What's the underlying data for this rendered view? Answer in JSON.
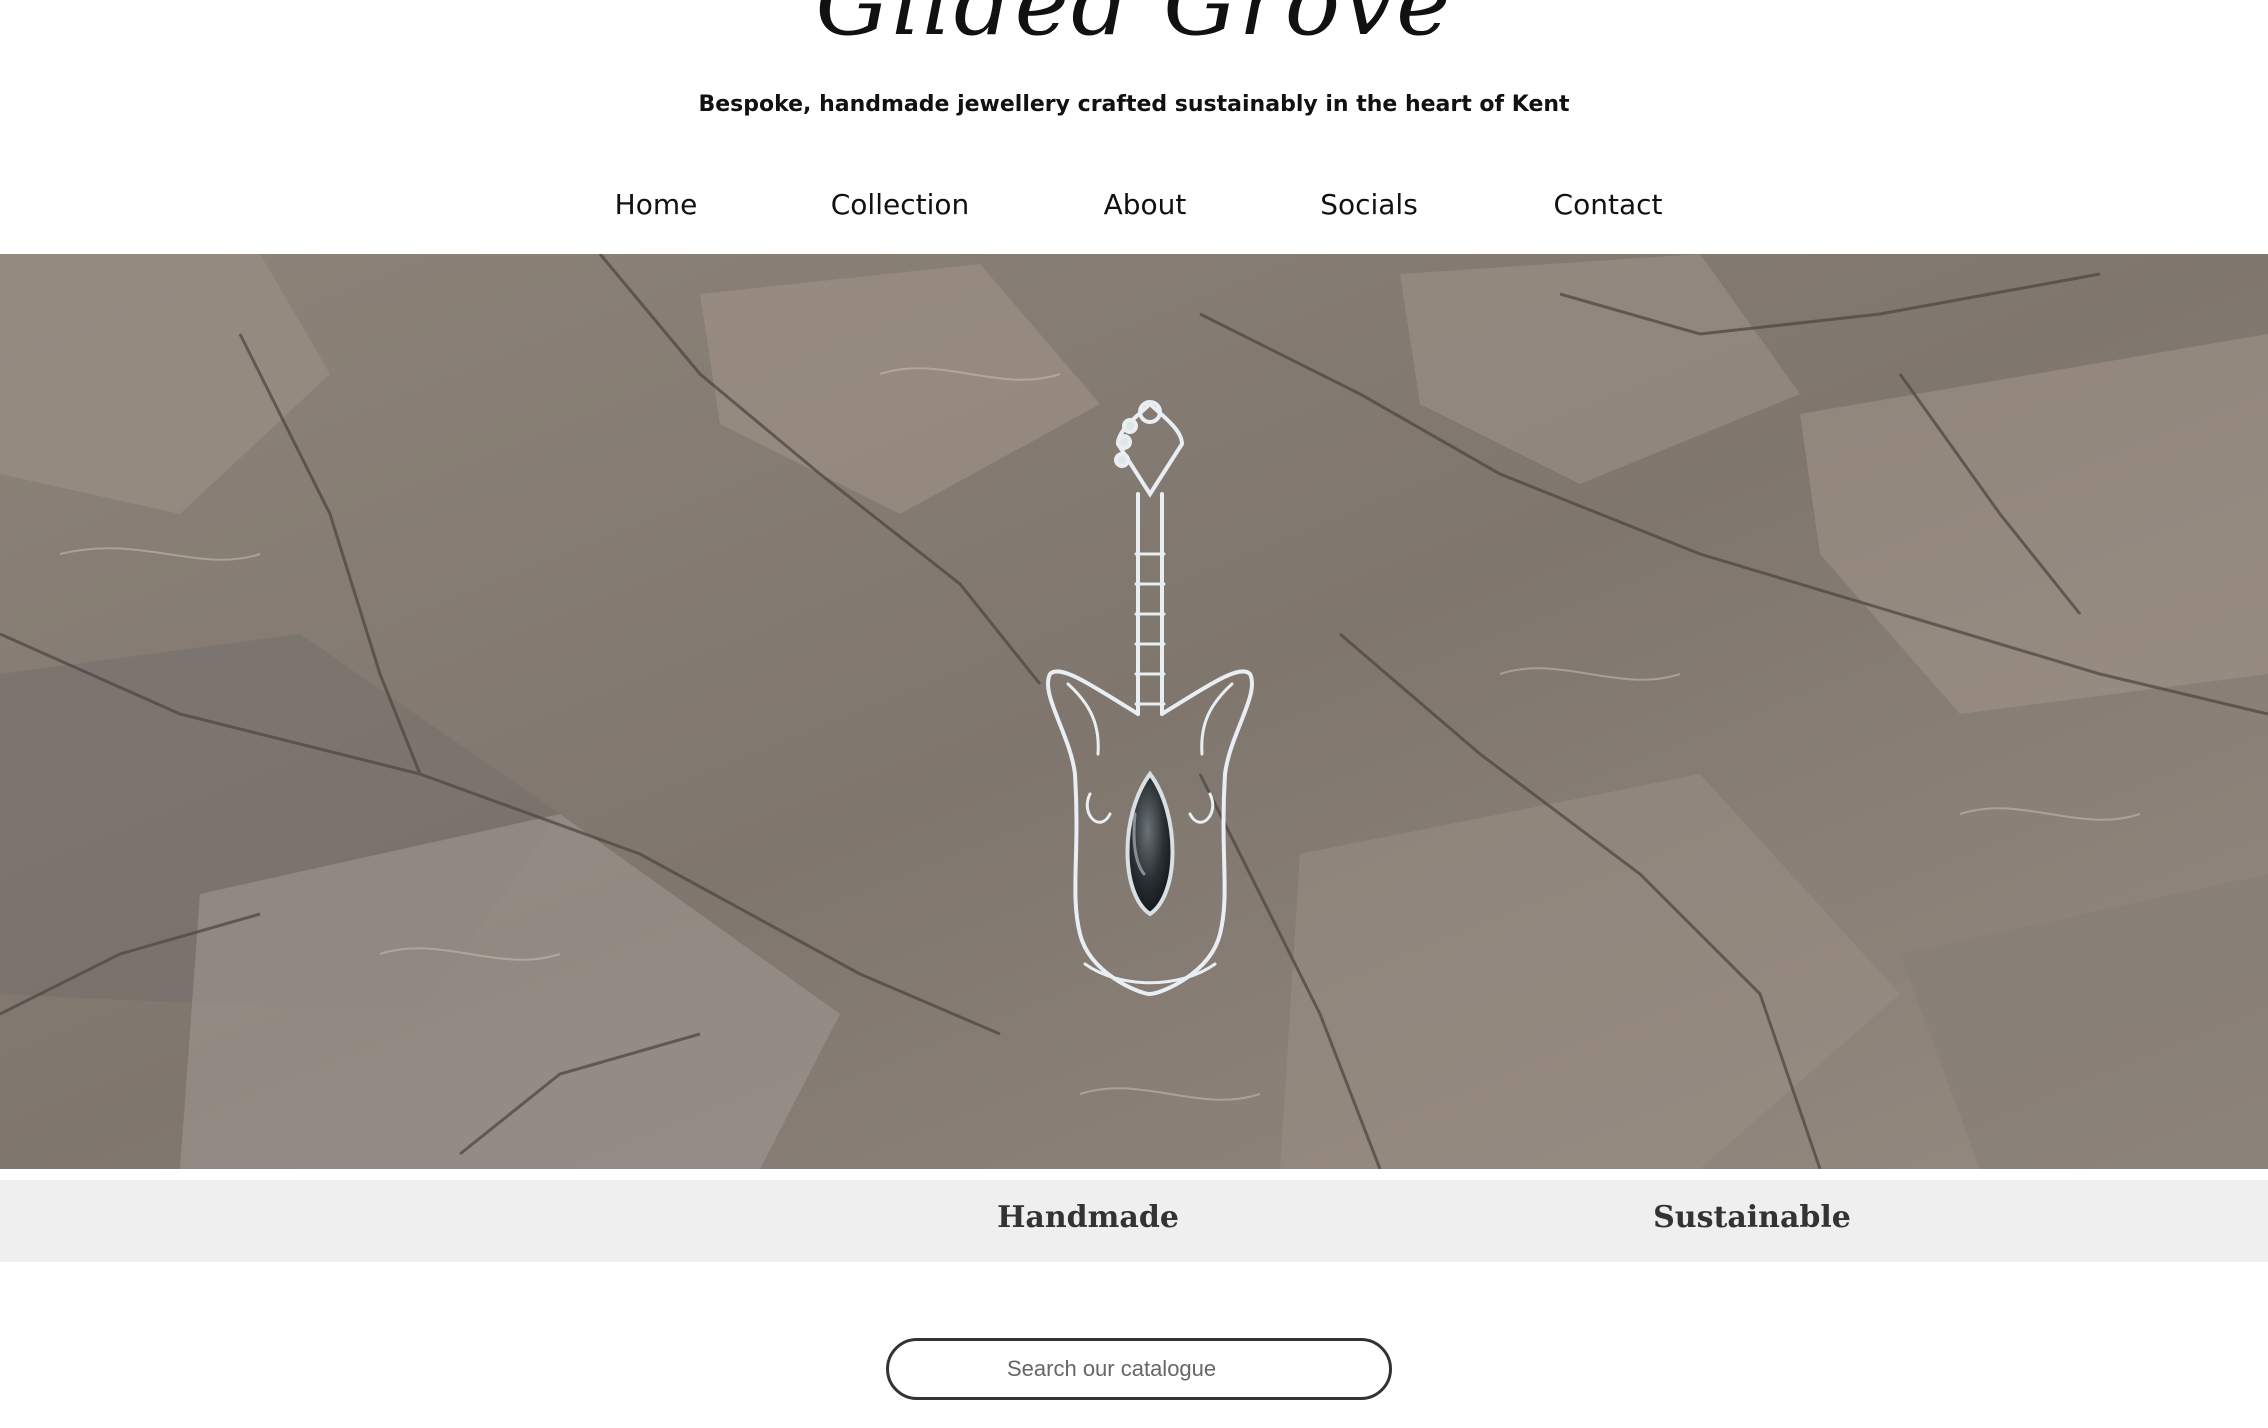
{
  "brand": {
    "title": "Gilded Grove",
    "tagline": "Bespoke, handmade jewellery crafted sustainably in the heart of Kent"
  },
  "nav": {
    "items": [
      {
        "label": "Home"
      },
      {
        "label": "Collection"
      },
      {
        "label": "About"
      },
      {
        "label": "Socials"
      },
      {
        "label": "Contact"
      }
    ]
  },
  "hero": {
    "image": "wire-wrapped-guitar-pendant-on-rock",
    "background_color": "#8c8177"
  },
  "features": {
    "items": [
      {
        "label": "Handmade"
      },
      {
        "label": "Sustainable"
      }
    ],
    "background_color": "#efefef"
  },
  "search": {
    "placeholder": "Search our catalogue",
    "value": ""
  }
}
